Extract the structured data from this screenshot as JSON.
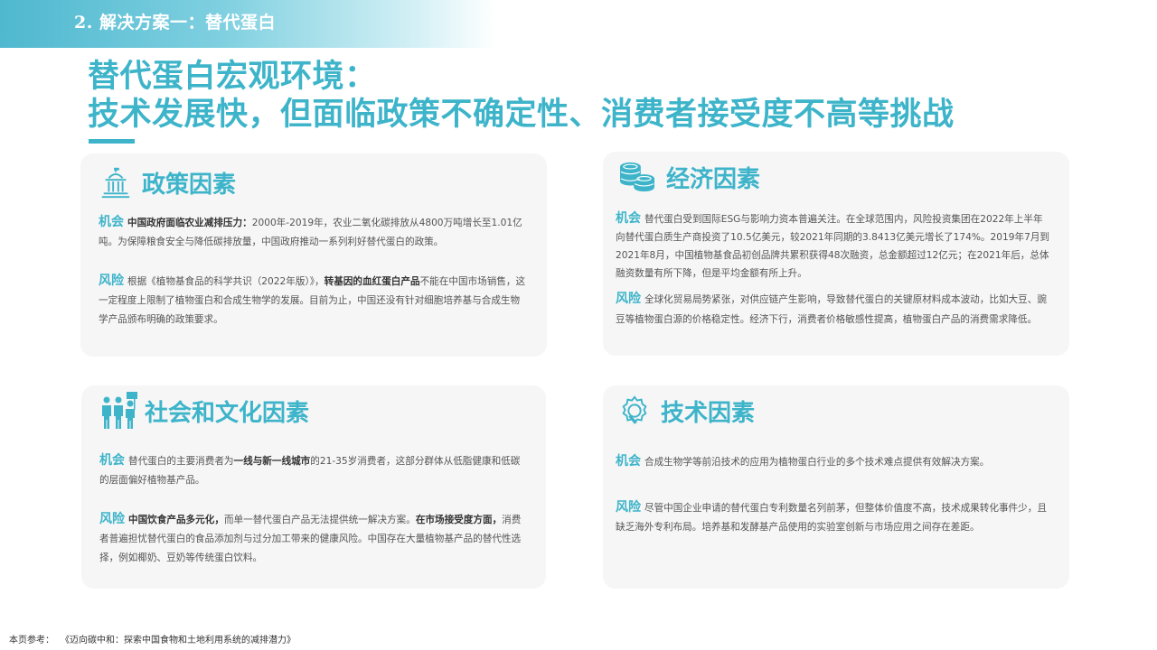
{
  "header": {
    "section_label": "2. 解决方案一：替代蛋白"
  },
  "title": {
    "line1": "替代蛋白宏观环境：",
    "line2": "技术发展快，但面临政策不确定性、消费者接受度不高等挑战"
  },
  "labels": {
    "opportunity": "机会",
    "risk": "风险"
  },
  "cards": {
    "policy": {
      "title": "政策因素",
      "icon": "government-building-icon",
      "opportunity": {
        "lead": "中国政府面临农业减排压力：",
        "text": "2000年-2019年，农业二氧化碳排放从4800万吨增长至1.01亿吨。为保障粮食安全与降低碳排放量，中国政府推动一系列利好替代蛋白的政策。"
      },
      "risk": {
        "pre": "根据《植物基食品的科学共识（2022年版）》，",
        "lead": "转基因的血红蛋白产品",
        "text": "不能在中国市场销售，这一定程度上限制了植物蛋白和合成生物学的发展。目前为止，中国还没有针对细胞培养基与合成生物学产品颁布明确的政策要求。"
      }
    },
    "economy": {
      "title": "经济因素",
      "icon": "coins-icon",
      "opportunity": {
        "text": "替代蛋白受到国际ESG与影响力资本普遍关注。在全球范围内，风险投资集团在2022年上半年向替代蛋白质生产商投资了10.5亿美元，较2021年同期的3.8413亿美元增长了174%。2019年7月到2021年8月，中国植物基食品初创品牌共累积获得48次融资，总金额超过12亿元；在2021年后，总体融资数量有所下降，但是平均金额有所上升。"
      },
      "risk": {
        "text": "全球化贸易局势紧张，对供应链产生影响，导致替代蛋白的关键原材料成本波动，比如大豆、豌豆等植物蛋白源的价格稳定性。经济下行，消费者价格敏感性提高，植物蛋白产品的消费需求降低。"
      }
    },
    "society": {
      "title": "社会和文化因素",
      "icon": "people-group-icon",
      "opportunity": {
        "pre": "替代蛋白的主要消费者为",
        "lead": "一线与新一线城市",
        "text": "的21-35岁消费者，这部分群体从低脂健康和低碳的层面偏好植物基产品。"
      },
      "risk": {
        "lead": "中国饮食产品多元化，",
        "text": "而单一替代蛋白产品无法提供统一解决方案。",
        "lead2": "在市场接受度方面，",
        "text2": "消费者普遍担忧替代蛋白的食品添加剂与过分加工带来的健康风险。中国存在大量植物基产品的替代性选择，例如椰奶、豆奶等传统蛋白饮料。"
      }
    },
    "technology": {
      "title": "技术因素",
      "icon": "gear-tech-icon",
      "opportunity": {
        "text": "合成生物学等前沿技术的应用为植物蛋白行业的多个技术难点提供有效解决方案。"
      },
      "risk": {
        "text": "尽管中国企业申请的替代蛋白专利数量名列前茅，但整体价值度不高，技术成果转化事件少，且缺乏海外专利布局。培养基和发酵基产品使用的实验室创新与市场应用之间存在差距。"
      }
    }
  },
  "footer": {
    "label": "本页参考：",
    "source": "《迈向碳中和：探索中国食物和土地利用系统的减排潜力》"
  },
  "colors": {
    "accent": "#3db4c9",
    "card_bg": "#f6f6f7"
  }
}
